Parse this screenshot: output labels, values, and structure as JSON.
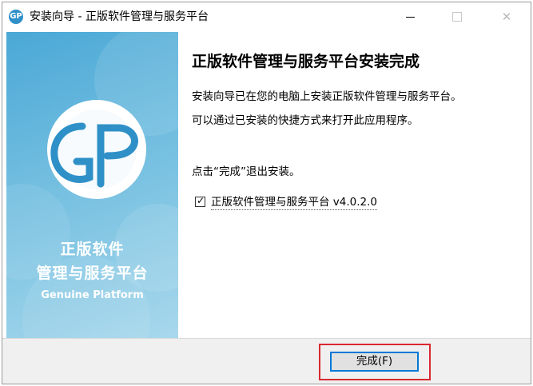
{
  "titlebar": {
    "icon_text": "GP",
    "title": "安装向导 - 正版软件管理与服务平台"
  },
  "sidebar": {
    "logo_text": "GP",
    "brand_cn_line1": "正版软件",
    "brand_cn_line2": "管理与服务平台",
    "brand_en": "Genuine Platform"
  },
  "content": {
    "heading": "正版软件管理与服务平台安装完成",
    "para1": "安装向导已在您的电脑上安装正版软件管理与服务平台。",
    "para2": "可以通过已安装的快捷方式来打开此应用程序。",
    "para3": "点击“完成”退出安装。",
    "launch_checkbox": {
      "checked": true,
      "label": "正版软件管理与服务平台 v4.0.2.0"
    }
  },
  "footer": {
    "finish_label": "完成(F)"
  },
  "colors": {
    "sidebar_blue": "#4aa8d6",
    "highlight_red": "#d9282f",
    "button_focus": "#0078d7"
  }
}
